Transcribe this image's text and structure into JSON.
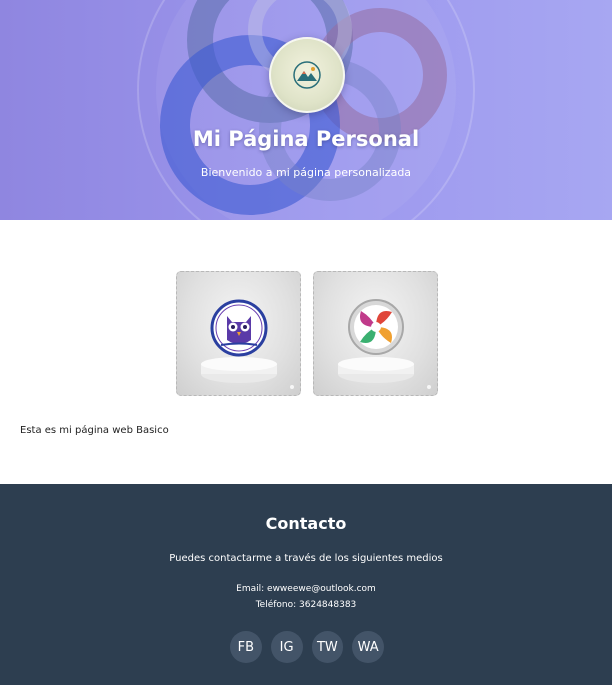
{
  "header": {
    "title": "Mi Página Personal",
    "subtitle": "Bienvenido a mi página personalizada",
    "avatar_icon": "mountain-logo-icon"
  },
  "gallery": {
    "items": [
      {
        "icon": "owl-logo-icon"
      },
      {
        "icon": "swirl-logo-icon"
      }
    ]
  },
  "main": {
    "intro": "Esta es mi página web Basico"
  },
  "footer": {
    "title": "Contacto",
    "text": "Puedes contactarme a través de los siguientes medios",
    "email": "Email: ewweewe@outlook.com",
    "phone": "Teléfono: 3624848383",
    "socials": [
      "FB",
      "IG",
      "TW",
      "WA"
    ]
  },
  "colors": {
    "hero_gradient_start": "#8f86e0",
    "hero_gradient_end": "#a7a7f2",
    "footer_bg": "#2d3e50",
    "social_bg": "#435468"
  }
}
